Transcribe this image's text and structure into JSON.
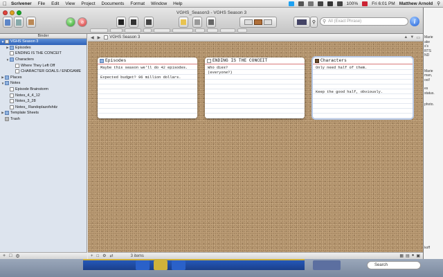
{
  "menubar": {
    "app_name": "Scrivener",
    "items": [
      "File",
      "Edit",
      "View",
      "Project",
      "Documents",
      "Format",
      "Window",
      "Help"
    ],
    "battery": "100%",
    "clock": "Fri 6:01 PM",
    "user": "Matthew Arnold"
  },
  "window": {
    "title": "VGHS_Season3 - VGHS Season 3"
  },
  "search": {
    "placeholder": "All (Exact Phrase)"
  },
  "binder": {
    "header": "Binder",
    "items": [
      {
        "label": "VGHS Season 3"
      },
      {
        "label": "Episodes"
      },
      {
        "label": "ENDING IS THE CONCEIT"
      },
      {
        "label": "Characters"
      },
      {
        "label": "Where They Left Off"
      },
      {
        "label": "CHARACTER GOALS / ENDGAME"
      },
      {
        "label": "Places"
      },
      {
        "label": "Notes"
      },
      {
        "label": "Episode Brainstorm"
      },
      {
        "label": "Notes_4_4_12"
      },
      {
        "label": "Notes_3_28"
      },
      {
        "label": "Notes_ Randoplazofshitz"
      },
      {
        "label": "Template Sheets"
      },
      {
        "label": "Trash"
      }
    ]
  },
  "editor": {
    "header_title": "VGHS Season 3",
    "cards": [
      {
        "title": "Episodes",
        "body": "Maybe this season we'll do 42 episodes.\n\nExpected budget? 96 million dollars."
      },
      {
        "title": "ENDING IS THE CONCEIT",
        "body": "Who dies?\n(everyone?)"
      },
      {
        "title": "Characters",
        "body": "Only need half of them.\n\n\n\n\nKeep the good half, obviously."
      }
    ],
    "footer_count": "3 items"
  },
  "background": {
    "right_text": [
      "Marie",
      "ake",
      "s's",
      "RTS",
      "ND",
      "Marie",
      "man,",
      "ool!",
      "es",
      "status.",
      "photo.",
      "koff"
    ],
    "search_label": "Search"
  }
}
